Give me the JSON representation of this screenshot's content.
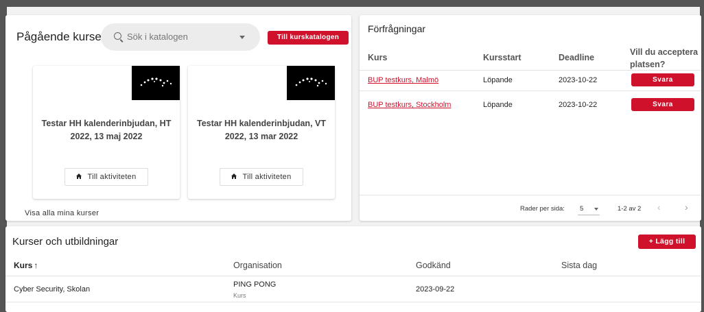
{
  "ongoing": {
    "title": "Pågående kurser",
    "search_placeholder": "Sök i katalogen",
    "catalog_button": "Till kurskatalogen",
    "courses": [
      {
        "title": "Testar HH kalenderinbjudan, HT 2022, 13 maj 2022",
        "action": "Till aktiviteten"
      },
      {
        "title": "Testar HH kalenderinbjudan, VT 2022, 13 mar 2022",
        "action": "Till aktiviteten"
      }
    ],
    "show_all": "Visa alla mina kurser"
  },
  "requests": {
    "title": "Förfrågningar",
    "columns": [
      "Kurs",
      "Kursstart",
      "Deadline",
      "Vill du acceptera platsen?"
    ],
    "rows": [
      {
        "course": "BUP testkurs, Malmö",
        "start": "Löpande",
        "deadline": "2023-10-22",
        "action": "Svara"
      },
      {
        "course": "BUP testkurs, Stockholm",
        "start": "Löpande",
        "deadline": "2023-10-22",
        "action": "Svara"
      }
    ],
    "rows_per_page_label": "Rader per sida:",
    "rows_per_page": "5",
    "range": "1-2 av 2"
  },
  "courses_edu": {
    "title": "Kurser och utbildningar",
    "add_button": "+ Lägg till",
    "columns": [
      "Kurs",
      "Organisation",
      "Godkänd",
      "Sista dag"
    ],
    "sort_indicator": "↑",
    "rows": [
      {
        "course": "Cyber Security, Skolan",
        "org": "PING PONG",
        "org_sub": "Kurs",
        "approved": "2023-09-22",
        "last_day": ""
      }
    ]
  },
  "colors": {
    "accent": "#d0112b",
    "frame": "#555555",
    "background": "#f2f2f2"
  }
}
